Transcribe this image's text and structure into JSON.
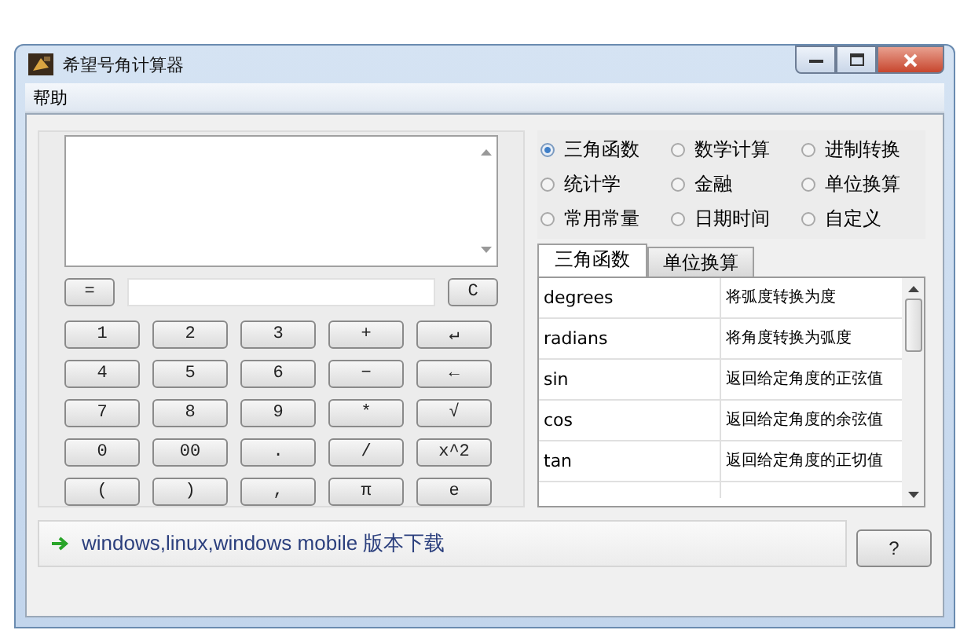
{
  "window": {
    "title": "希望号角计算器"
  },
  "menu": [
    {
      "label": "帮助"
    }
  ],
  "input_row": {
    "equals": "=",
    "clear": "C"
  },
  "keypad": [
    [
      "1",
      "2",
      "3",
      "+",
      "↵"
    ],
    [
      "4",
      "5",
      "6",
      "−",
      "←"
    ],
    [
      "7",
      "8",
      "9",
      "*",
      "√"
    ],
    [
      "0",
      "00",
      ".",
      "/",
      "x^2"
    ],
    [
      "(",
      ")",
      ",",
      "π",
      "e"
    ]
  ],
  "categories": [
    {
      "label": "三角函数",
      "selected": true
    },
    {
      "label": "数学计算",
      "selected": false
    },
    {
      "label": "进制转换",
      "selected": false
    },
    {
      "label": "统计学",
      "selected": false
    },
    {
      "label": "金融",
      "selected": false
    },
    {
      "label": "单位换算",
      "selected": false
    },
    {
      "label": "常用常量",
      "selected": false
    },
    {
      "label": "日期时间",
      "selected": false
    },
    {
      "label": "自定义",
      "selected": false
    }
  ],
  "tabs": [
    {
      "label": "三角函数",
      "selected": true
    },
    {
      "label": "单位换算",
      "selected": false
    }
  ],
  "functions": [
    {
      "name": "degrees",
      "description": "将弧度转换为度"
    },
    {
      "name": "radians",
      "description": "将角度转换为弧度"
    },
    {
      "name": "sin",
      "description": "返回给定角度的正弦值"
    },
    {
      "name": "cos",
      "description": "返回给定角度的余弦值"
    },
    {
      "name": "tan",
      "description": "返回给定角度的正切值"
    }
  ],
  "download_link": "windows,linux,windows mobile 版本下载",
  "help_button": "?"
}
